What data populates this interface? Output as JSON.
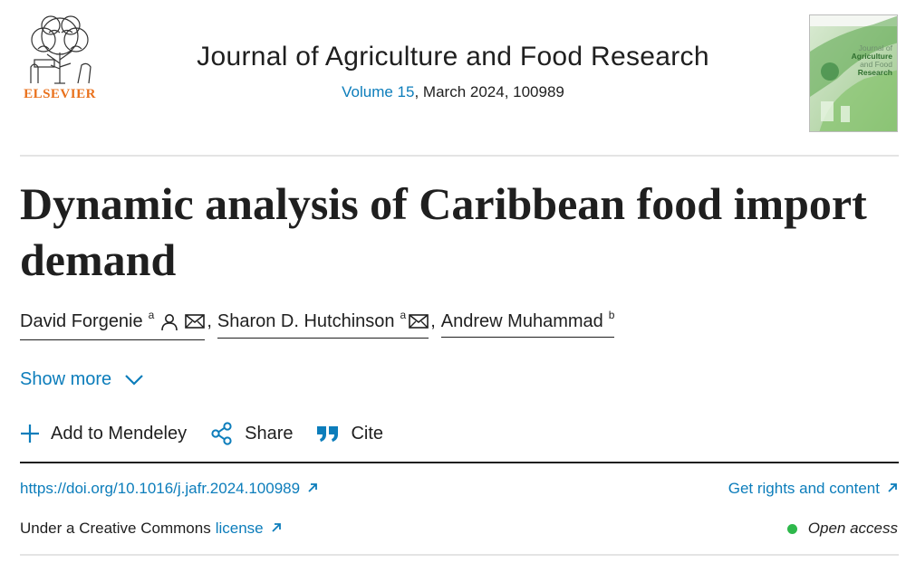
{
  "header": {
    "publisher": "ELSEVIER",
    "journal_title": "Journal of Agriculture and Food Research",
    "volume_link": "Volume 15",
    "issue_info": ", March 2024, 100989",
    "cover": {
      "line1": "Journal of",
      "line2": "Agriculture",
      "line3": "and Food",
      "line4": "Research"
    }
  },
  "article": {
    "title": "Dynamic analysis of Caribbean food import demand",
    "authors": [
      {
        "name": "David Forgenie",
        "affiliation": "a",
        "icons": [
          "person-icon",
          "email-icon"
        ]
      },
      {
        "name": "Sharon D. Hutchinson",
        "affiliation": "a",
        "icons": [
          "email-icon"
        ]
      },
      {
        "name": "Andrew Muhammad",
        "affiliation": "b",
        "icons": []
      }
    ],
    "author_separator": ","
  },
  "show_more": {
    "label": "Show more"
  },
  "actions": {
    "mendeley": "Add to Mendeley",
    "share": "Share",
    "cite": "Cite"
  },
  "links": {
    "doi": "https://doi.org/10.1016/j.jafr.2024.100989",
    "rights": "Get rights and content",
    "license_prefix": "Under a Creative Commons",
    "license_link": "license",
    "open_access": "Open access"
  },
  "colors": {
    "link": "#0c7dbb",
    "elsevier_orange": "#e9711c",
    "open_access_dot": "#2eb84b",
    "text": "#1f1f1f"
  }
}
